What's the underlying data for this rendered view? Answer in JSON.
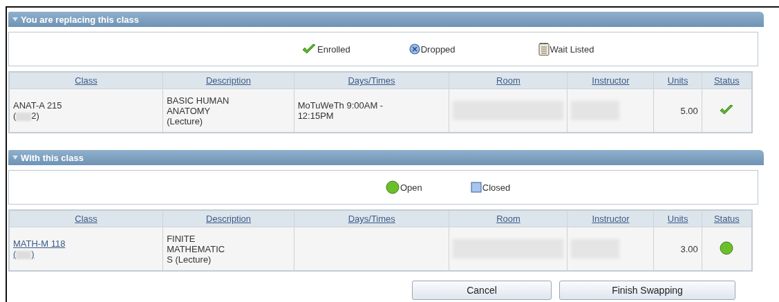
{
  "sections": [
    {
      "title": "You are replacing this class",
      "expanded": true,
      "legend": [
        {
          "kind": "enrolled",
          "label": "Enrolled"
        },
        {
          "kind": "dropped",
          "label": "Dropped"
        },
        {
          "kind": "waitlisted",
          "label": "Wait Listed"
        }
      ],
      "table": {
        "columns": [
          "Class",
          "Description",
          "Days/Times",
          "Room",
          "Instructor",
          "Units",
          "Status"
        ],
        "rows": [
          {
            "class": "ANAT-A 215",
            "class_link": false,
            "class_number_prefix": "(",
            "class_number_suffix": "2)",
            "description": [
              "BASIC HUMAN",
              "ANATOMY",
              "(Lecture)"
            ],
            "days_times": [
              "MoTuWeTh 9:00AM -",
              "12:15PM"
            ],
            "room_redacted": true,
            "instructor_redacted": true,
            "units": "5.00",
            "status": {
              "kind": "enrolled"
            }
          }
        ]
      }
    },
    {
      "title": "With this class",
      "expanded": true,
      "legend": [
        {
          "kind": "open",
          "label": "Open"
        },
        {
          "kind": "closed",
          "label": "Closed"
        }
      ],
      "table": {
        "columns": [
          "Class",
          "Description",
          "Days/Times",
          "Room",
          "Instructor",
          "Units",
          "Status"
        ],
        "rows": [
          {
            "class": "MATH-M 118",
            "class_link": true,
            "class_number_prefix": "(",
            "class_number_suffix": ")",
            "description": [
              "FINITE",
              "MATHEMATIC",
              "S (Lecture)"
            ],
            "days_times": [],
            "room_redacted": true,
            "instructor_redacted": true,
            "units": "3.00",
            "status": {
              "kind": "open"
            }
          }
        ]
      }
    }
  ],
  "buttons": [
    "Cancel",
    "Finish Swapping"
  ]
}
